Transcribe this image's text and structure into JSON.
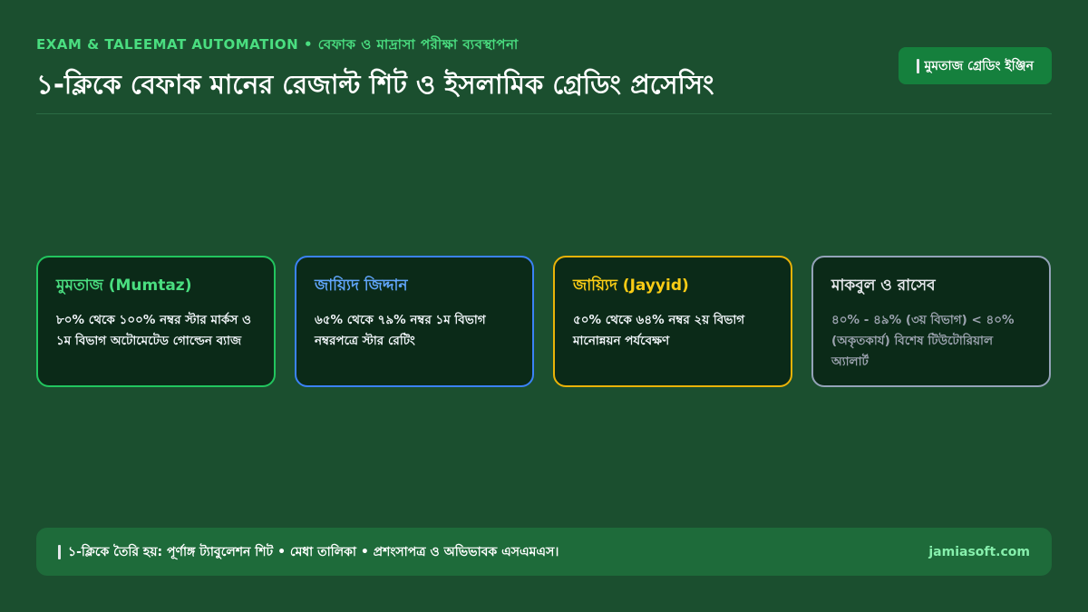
{
  "header": {
    "eyebrow_en": "EXAM & TALEEMAT AUTOMATION",
    "eyebrow_sep": " • ",
    "eyebrow_bn": "বেফাক ও মাদ্রাসা পরীক্ষা ব্যবস্থাপনা",
    "title": "১-ক্লিকে বেফাক মানের রেজাল্ট শিট ও ইসলামিক গ্রেডিং প্রসেসিং"
  },
  "badge": {
    "icon": "box-icon",
    "label": "মুমতাজ গ্রেডিং ইঞ্জিন"
  },
  "cards": [
    {
      "title": "মুমতাজ (Mumtaz)",
      "body": "৮০% থেকে ১০০% নম্বর স্টার মার্কস ও ১ম বিভাগ অটোমেটেড গোল্ডেন ব্যাজ",
      "color": "#22c55e"
    },
    {
      "title": "জায়্যিদ জিদ্দান",
      "body": "৬৫% থেকে ৭৯% নম্বর ১ম বিভাগ নম্বরপত্রে স্টার রেটিং",
      "color": "#3b82f6"
    },
    {
      "title": "জায়্যিদ (Jayyid)",
      "body": "৫০% থেকে ৬৪% নম্বর ২য় বিভাগ মানোন্নয়ন পর্যবেক্ষণ",
      "color": "#eab308"
    },
    {
      "title": "মাকবুল ও রাসেব",
      "body": "৪০% - ৪৯% (৩য় বিভাগ) < ৪০% (অকৃতকার্য) বিশেষ টিউটোরিয়াল অ্যালার্ট",
      "color": "#94a3b8"
    }
  ],
  "footer": {
    "icon": "box-icon",
    "text": "১-ক্লিকে তৈরি হয়: পূর্ণাঙ্গ ট্যাবুলেশন শিট • মেধা তালিকা • প্রশংসাপত্র ও অভিভাবক এসএমএস।",
    "brand": "jamiasoft.com"
  },
  "colors": {
    "background": "#1b4f2f",
    "accent": "#4ade80"
  }
}
